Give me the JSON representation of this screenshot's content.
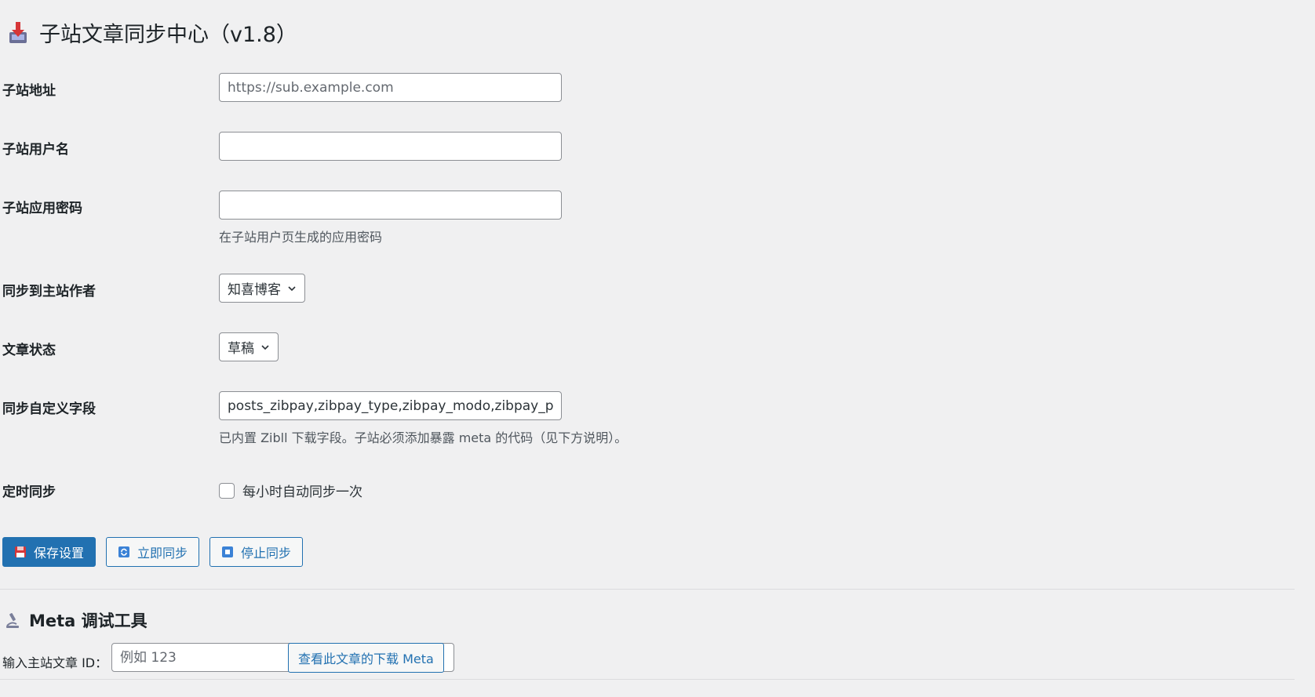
{
  "page": {
    "title": "子站文章同步中心（v1.8）"
  },
  "form": {
    "site_url": {
      "label": "子站地址",
      "value": "",
      "placeholder": "https://sub.example.com"
    },
    "username": {
      "label": "子站用户名",
      "value": ""
    },
    "app_password": {
      "label": "子站应用密码",
      "value": "",
      "description": "在子站用户页生成的应用密码"
    },
    "author": {
      "label": "同步到主站作者",
      "selected": "知喜博客"
    },
    "status": {
      "label": "文章状态",
      "selected": "草稿"
    },
    "custom_fields": {
      "label": "同步自定义字段",
      "value": "posts_zibpay,zibpay_type,zibpay_modo,zibpay_price,zi",
      "description": "已内置 Zibll 下载字段。子站必须添加暴露 meta 的代码（见下方说明）。"
    },
    "schedule": {
      "label": "定时同步",
      "checkbox_label": "每小时自动同步一次",
      "checked": false
    }
  },
  "buttons": {
    "save": "保存设置",
    "sync_now": "立即同步",
    "stop_sync": "停止同步"
  },
  "meta_debug": {
    "title": "Meta 调试工具",
    "input_label": "输入主站文章 ID：",
    "input_placeholder": "例如 123",
    "button": "查看此文章的下载 Meta"
  },
  "colors": {
    "background": "#f0f0f1",
    "primary": "#2271b1",
    "border": "#8c8f94",
    "icon_red": "#d63638"
  }
}
